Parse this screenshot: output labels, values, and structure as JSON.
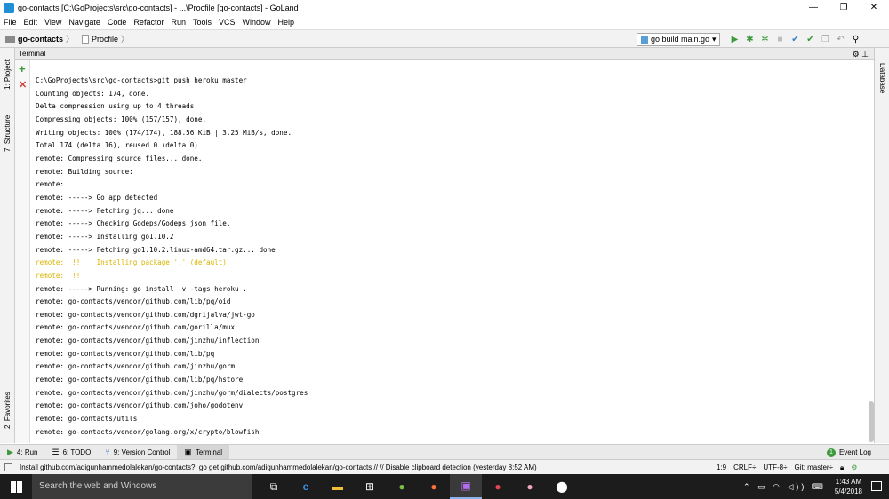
{
  "window": {
    "title": "go-contacts [C:\\GoProjects\\src\\go-contacts] - ...\\Procfile [go-contacts] - GoLand",
    "minimize": "—",
    "maximize": "❐",
    "close": "✕"
  },
  "menu": [
    "File",
    "Edit",
    "View",
    "Navigate",
    "Code",
    "Refactor",
    "Run",
    "Tools",
    "VCS",
    "Window",
    "Help"
  ],
  "breadcrumb": {
    "project": "go-contacts",
    "file": "Procfile"
  },
  "toolbar": {
    "run_config": "go build main.go",
    "icons": [
      "run-icon",
      "debug-icon",
      "coverage-icon",
      "stop-icon",
      "vcs-update-icon",
      "vcs-commit-icon",
      "compare-icon",
      "revert-icon",
      "search-icon"
    ]
  },
  "left_tabs": {
    "project": "1: Project",
    "structure": "7: Structure",
    "favorites": "2: Favorites"
  },
  "right_tabs": {
    "database": "Database"
  },
  "terminal": {
    "title": "Terminal",
    "lines": [
      "C:\\GoProjects\\src\\go-contacts>git push heroku master",
      "Counting objects: 174, done.",
      "Delta compression using up to 4 threads.",
      "Compressing objects: 100% (157/157), done.",
      "Writing objects: 100% (174/174), 188.56 KiB | 3.25 MiB/s, done.",
      "Total 174 (delta 16), reused 0 (delta 0)",
      "remote: Compressing source files... done.",
      "remote: Building source:",
      "remote:",
      "remote: -----> Go app detected",
      "remote: -----> Fetching jq... done",
      "remote: -----> Checking Godeps/Godeps.json file.",
      "remote: -----> Installing go1.10.2",
      "remote: -----> Fetching go1.10.2.linux-amd64.tar.gz... done",
      "remote:  !!    Installing package '.' (default)",
      "remote:  !!",
      "remote: -----> Running: go install -v -tags heroku .",
      "remote: go-contacts/vendor/github.com/lib/pq/oid",
      "remote: go-contacts/vendor/github.com/dgrijalva/jwt-go",
      "remote: go-contacts/vendor/github.com/gorilla/mux",
      "remote: go-contacts/vendor/github.com/jinzhu/inflection",
      "remote: go-contacts/vendor/github.com/lib/pq",
      "remote: go-contacts/vendor/github.com/jinzhu/gorm",
      "remote: go-contacts/vendor/github.com/lib/pq/hstore",
      "remote: go-contacts/vendor/github.com/jinzhu/gorm/dialects/postgres",
      "remote: go-contacts/vendor/github.com/joho/godotenv",
      "remote: go-contacts/utils",
      "remote: go-contacts/vendor/golang.org/x/crypto/blowfish"
    ],
    "warn_color": "#d8b400"
  },
  "bottom_tabs": [
    {
      "label": "4: Run",
      "icon": "run-icon"
    },
    {
      "label": "6: TODO",
      "icon": "todo-icon"
    },
    {
      "label": "9: Version Control",
      "icon": "version-control-icon"
    },
    {
      "label": "Terminal",
      "icon": "terminal-icon"
    }
  ],
  "event_log": {
    "label": "Event Log",
    "count": "1"
  },
  "status": {
    "message": "Install github.com/adigunhammedolalekan/go-contacts?: go get github.com/adigunhammedolalekan/go-contacts // // Disable clipboard detection (yesterday 8:52 AM)",
    "position": "1:9",
    "line_sep": "CRLF÷",
    "encoding": "UTF-8÷",
    "git": "Git: master÷"
  },
  "taskbar": {
    "search_placeholder": "Search the web and Windows",
    "time": "1:43 AM",
    "date": "5/4/2018",
    "apps": [
      "task-view-icon",
      "edge-icon",
      "file-explorer-icon",
      "store-icon",
      "app-icon",
      "firefox-icon",
      "goland-icon",
      "app-red-icon",
      "app-pink-icon",
      "app-dark-icon"
    ]
  },
  "colors": {
    "accent": "#3c9a3c",
    "taskbar": "#1c1c1c",
    "warning": "#d8b400"
  }
}
